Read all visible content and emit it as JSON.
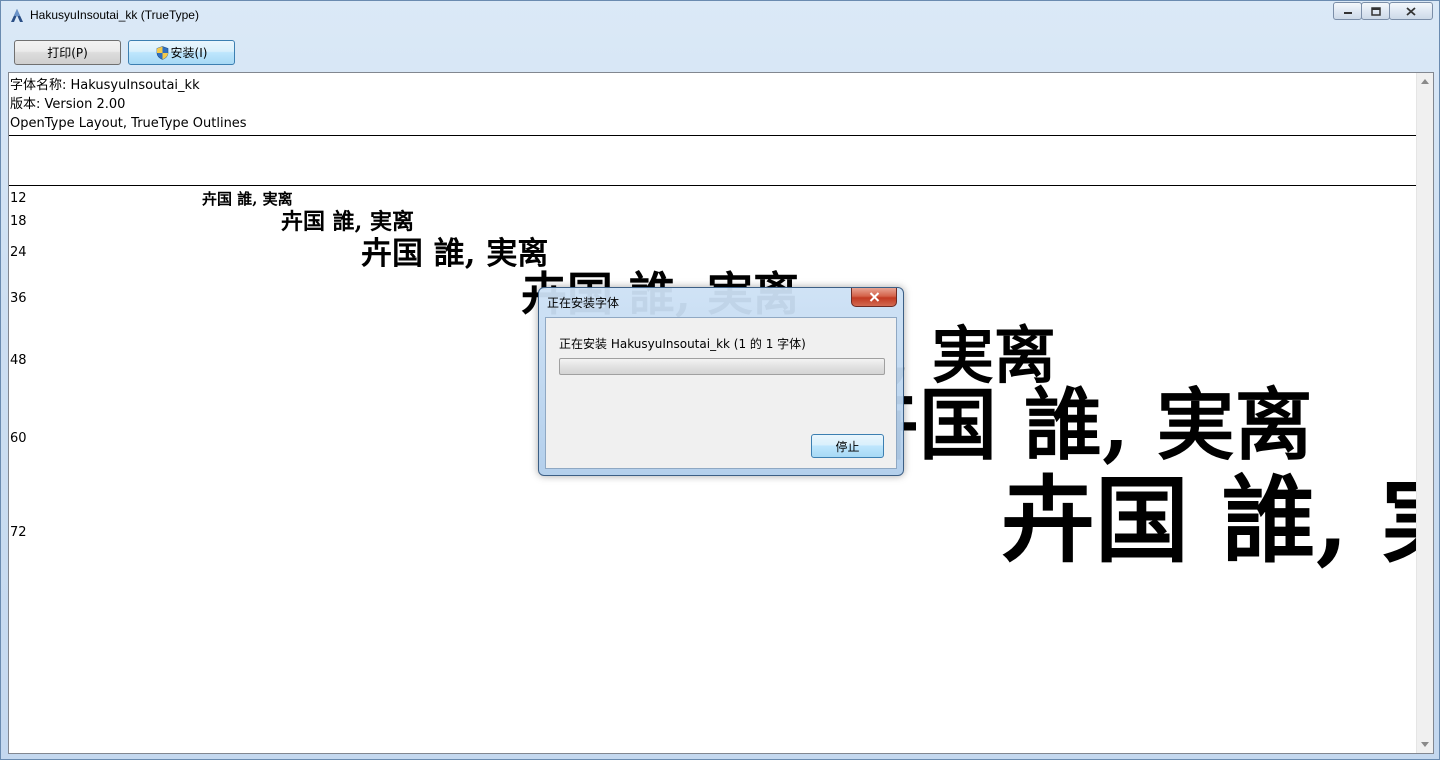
{
  "window": {
    "title": "HakusyuInsoutai_kk (TrueType)"
  },
  "toolbar": {
    "print_label": "打印(P)",
    "install_label": "安装(I)"
  },
  "font_info": {
    "name_line": "字体名称: HakusyuInsoutai_kk",
    "version_line": "版本: Version 2.00",
    "type_line": "OpenType Layout, TrueType Outlines"
  },
  "samples": {
    "text": "卉国 誰,  実离",
    "rows": [
      {
        "size": "12"
      },
      {
        "size": "18"
      },
      {
        "size": "24"
      },
      {
        "size": "36"
      },
      {
        "size": "48"
      },
      {
        "size": "60"
      },
      {
        "size": "72"
      }
    ]
  },
  "dialog": {
    "title": "正在安装字体",
    "message": "正在安装 HakusyuInsoutai_kk (1 的 1 字体)",
    "progress_percent": 0,
    "stop_label": "停止"
  },
  "icons": {
    "app": "font-viewer-icon",
    "minimize": "minimize-icon",
    "maximize": "maximize-icon",
    "close": "close-icon",
    "shield": "uac-shield-icon"
  }
}
